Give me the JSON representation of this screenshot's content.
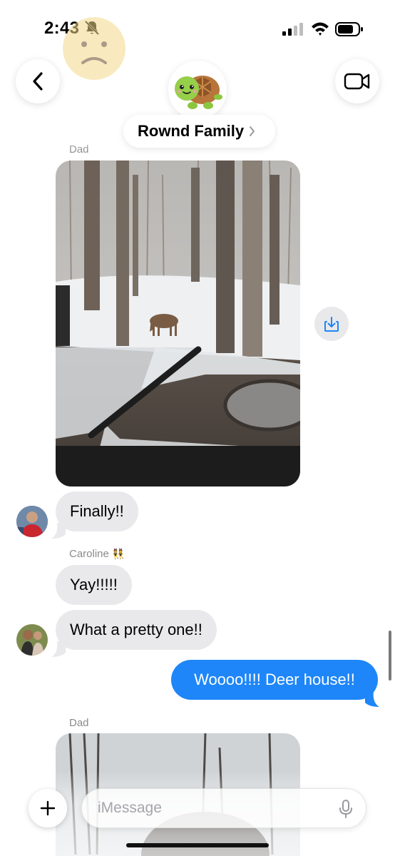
{
  "status_bar": {
    "time": "2:43",
    "icons": [
      "bell-slash-icon",
      "cellular-signal-icon",
      "wifi-icon",
      "battery-icon"
    ]
  },
  "header": {
    "group_name": "Rownd Family",
    "group_avatar": "turtle-emoji",
    "back_icon": "chevron-left-icon",
    "video_icon": "video-camera-icon"
  },
  "messages": [
    {
      "type": "photo",
      "sender": "Dad",
      "description_icon": "photo-deer-in-snow"
    },
    {
      "type": "text",
      "direction": "received",
      "text": "Finally!!"
    },
    {
      "type": "text",
      "direction": "received",
      "sender": "Caroline",
      "sender_emoji": "👯",
      "text": "Yay!!!!!"
    },
    {
      "type": "text",
      "direction": "received",
      "text": "What a pretty one!!"
    },
    {
      "type": "text",
      "direction": "sent",
      "text": "Woooo!!!! Deer house!!"
    },
    {
      "type": "photo",
      "sender": "Dad",
      "description_icon": "photo-window-view"
    }
  ],
  "composer": {
    "placeholder": "iMessage",
    "plus_icon": "plus-icon",
    "mic_icon": "microphone-icon"
  },
  "colors": {
    "sent_bubble": "#1e86f8",
    "received_bubble": "#e9e9eb",
    "secondary_text": "#8a8a8e",
    "accent": "#1e86f8"
  }
}
